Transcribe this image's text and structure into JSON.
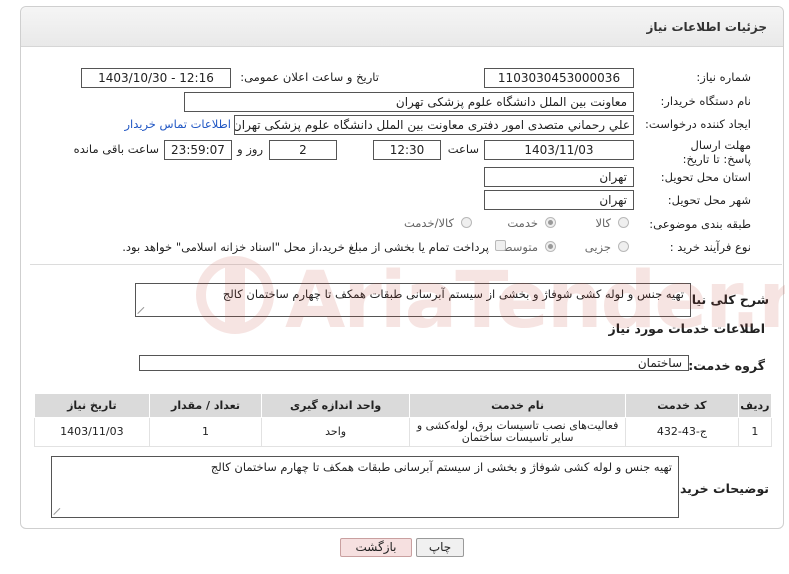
{
  "header": {
    "title": "جزئیات اطلاعات نیاز"
  },
  "fields": {
    "need_number_label": "شماره نیاز:",
    "need_number": "1103030453000036",
    "announce_label": "تاریخ و ساعت اعلان عمومی:",
    "announce_value": "1403/10/30 - 12:16",
    "buyer_org_label": "نام دستگاه خریدار:",
    "buyer_org": "معاونت بین الملل دانشگاه علوم پزشکی تهران",
    "creator_label": "ایجاد کننده درخواست:",
    "creator": "علي رحماني متصدی امور دفتری معاونت بین الملل دانشگاه علوم پزشکی تهران",
    "contact_link": "اطلاعات تماس خریدار",
    "deadline_label": "مهلت ارسال پاسخ: تا تاریخ:",
    "deadline_date": "1403/11/03",
    "time_label": "ساعت",
    "deadline_time": "12:30",
    "days_count": "2",
    "days_label": "روز و",
    "remaining_time": "23:59:07",
    "remaining_label": "ساعت باقی مانده",
    "province_label": "استان محل تحویل:",
    "province": "تهران",
    "city_label": "شهر محل تحویل:",
    "city": "تهران",
    "category_label": "طبقه بندی موضوعی:",
    "category_options": [
      "کالا",
      "خدمت",
      "کالا/خدمت"
    ],
    "category_selected": "خدمت",
    "process_label": "نوع فرآیند خرید :",
    "process_options": [
      "جزیی",
      "متوسط"
    ],
    "process_selected": "متوسط",
    "payment_note": "پرداخت تمام یا بخشی از مبلغ خرید،از محل \"اسناد خزانه اسلامی\" خواهد بود."
  },
  "summary": {
    "label": "شرح کلی نیاز:",
    "text": "تهیه جنس و لوله کشی شوفاژ و بخشی از سیستم آبرسانی طبقات همکف تا چهارم ساختمان کالج"
  },
  "services": {
    "section_title": "اطلاعات خدمات مورد نیاز",
    "group_label": "گروه خدمت:",
    "group_value": "ساختمان",
    "columns": [
      "ردیف",
      "کد خدمت",
      "نام خدمت",
      "واحد اندازه گیری",
      "تعداد / مقدار",
      "تاریخ نیاز"
    ],
    "rows": [
      {
        "index": "1",
        "code": "ج-43-432",
        "name": "فعالیت‌های نصب تاسیسات برق، لوله‌کشی و سایر تاسیسات ساختمان",
        "unit": "واحد",
        "qty": "1",
        "date": "1403/11/03"
      }
    ]
  },
  "buyer_notes": {
    "label": "توضیحات خریدار:",
    "text": "تهیه جنس و لوله کشی شوفاژ و بخشی از سیستم آبرسانی طبقات همکف تا چهارم ساختمان کالج"
  },
  "buttons": {
    "print": "چاپ",
    "back": "بازگشت"
  },
  "watermark": {
    "text": "AriaTender.net",
    "color": "#c0392b"
  }
}
